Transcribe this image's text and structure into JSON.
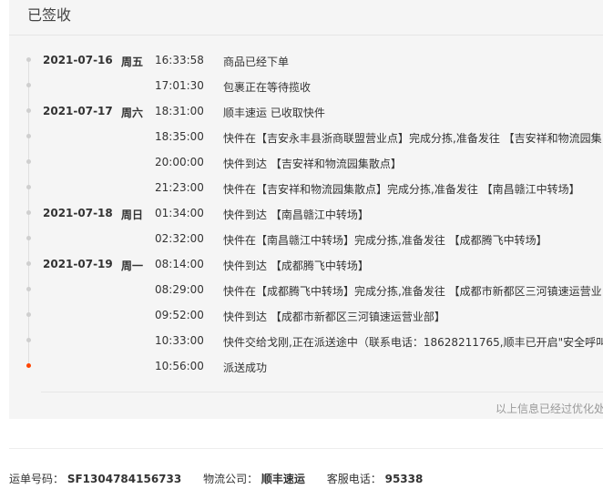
{
  "header": {
    "status": "已签收"
  },
  "events": [
    {
      "date": "2021-07-16",
      "weekday": "周五",
      "time": "16:33:58",
      "desc": "商品已经下单"
    },
    {
      "date": "",
      "weekday": "",
      "time": "17:01:30",
      "desc": "包裹正在等待揽收"
    },
    {
      "date": "2021-07-17",
      "weekday": "周六",
      "time": "18:31:00",
      "desc": "顺丰速运 已收取快件"
    },
    {
      "date": "",
      "weekday": "",
      "time": "18:35:00",
      "desc": "快件在【吉安永丰县浙商联盟营业点】完成分拣,准备发往 【吉安祥和物流园集"
    },
    {
      "date": "",
      "weekday": "",
      "time": "20:00:00",
      "desc": "快件到达 【吉安祥和物流园集散点】"
    },
    {
      "date": "",
      "weekday": "",
      "time": "21:23:00",
      "desc": "快件在【吉安祥和物流园集散点】完成分拣,准备发往 【南昌赣江中转场】"
    },
    {
      "date": "2021-07-18",
      "weekday": "周日",
      "time": "01:34:00",
      "desc": "快件到达 【南昌赣江中转场】"
    },
    {
      "date": "",
      "weekday": "",
      "time": "02:32:00",
      "desc": "快件在【南昌赣江中转场】完成分拣,准备发往 【成都腾飞中转场】"
    },
    {
      "date": "2021-07-19",
      "weekday": "周一",
      "time": "08:14:00",
      "desc": "快件到达 【成都腾飞中转场】"
    },
    {
      "date": "",
      "weekday": "",
      "time": "08:29:00",
      "desc": "快件在【成都腾飞中转场】完成分拣,准备发往 【成都市新都区三河镇速运营业"
    },
    {
      "date": "",
      "weekday": "",
      "time": "09:52:00",
      "desc": "快件到达 【成都市新都区三河镇速运营业部】"
    },
    {
      "date": "",
      "weekday": "",
      "time": "10:33:00",
      "desc": "快件交给戈刚,正在派送途中（联系电话：18628211765,顺丰已开启\"安全呼叫\""
    },
    {
      "date": "",
      "weekday": "",
      "time": "10:56:00",
      "desc": "派送成功"
    }
  ],
  "notice": "以上信息已经过优化处",
  "footer": {
    "tracking_label": "运单号码：",
    "tracking_number": "SF1304784156733",
    "carrier_label": "物流公司：",
    "carrier": "顺丰速运",
    "service_label": "客服电话：",
    "service_phone": "95338"
  },
  "colors": {
    "current_dot": "#ff4400",
    "panel_bg": "#f5f5f5"
  }
}
